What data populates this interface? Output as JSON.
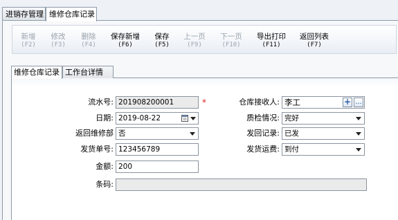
{
  "top_tabs": [
    "进销存管理",
    "维修仓库记录"
  ],
  "toolbar": [
    {
      "label": "新增",
      "key": "(F2)",
      "enabled": false
    },
    {
      "label": "修改",
      "key": "(F3)",
      "enabled": false
    },
    {
      "label": "删除",
      "key": "(F4)",
      "enabled": false
    },
    {
      "label": "保存新增",
      "key": "(F6)",
      "enabled": true
    },
    {
      "label": "保存",
      "key": "(F5)",
      "enabled": true
    },
    {
      "label": "上一页",
      "key": "(F9)",
      "enabled": false
    },
    {
      "label": "下一页",
      "key": "(F10)",
      "enabled": false
    },
    {
      "label": "导出打印",
      "key": "(F11)",
      "enabled": true
    },
    {
      "label": "返回列表",
      "key": "(F7)",
      "enabled": true
    }
  ],
  "inner_tabs": [
    "维修仓库记录",
    "工作台详情"
  ],
  "form": {
    "serial_label": "流水号:",
    "serial_value": "201908200001",
    "required_mark": "*",
    "date_label": "日期:",
    "date_value": "2019-08-22",
    "return_dept_label": "返回维修部",
    "return_dept_value": "否",
    "shipment_no_label": "发货单号:",
    "shipment_no_value": "123456789",
    "amount_label": "金额:",
    "amount_value": "200",
    "barcode_label": "条码:",
    "barcode_value": "",
    "receiver_label": "仓库接收人:",
    "receiver_value": "李工",
    "qc_label": "质检情况:",
    "qc_value": "完好",
    "return_record_label": "发回记录:",
    "return_record_value": "已发",
    "freight_label": "发货运费:",
    "freight_value": "到付",
    "add_glyph": "+",
    "more_glyph": "..."
  },
  "icons": {
    "calendar": "calendar-icon",
    "dropdown": "chevron-down-icon"
  }
}
